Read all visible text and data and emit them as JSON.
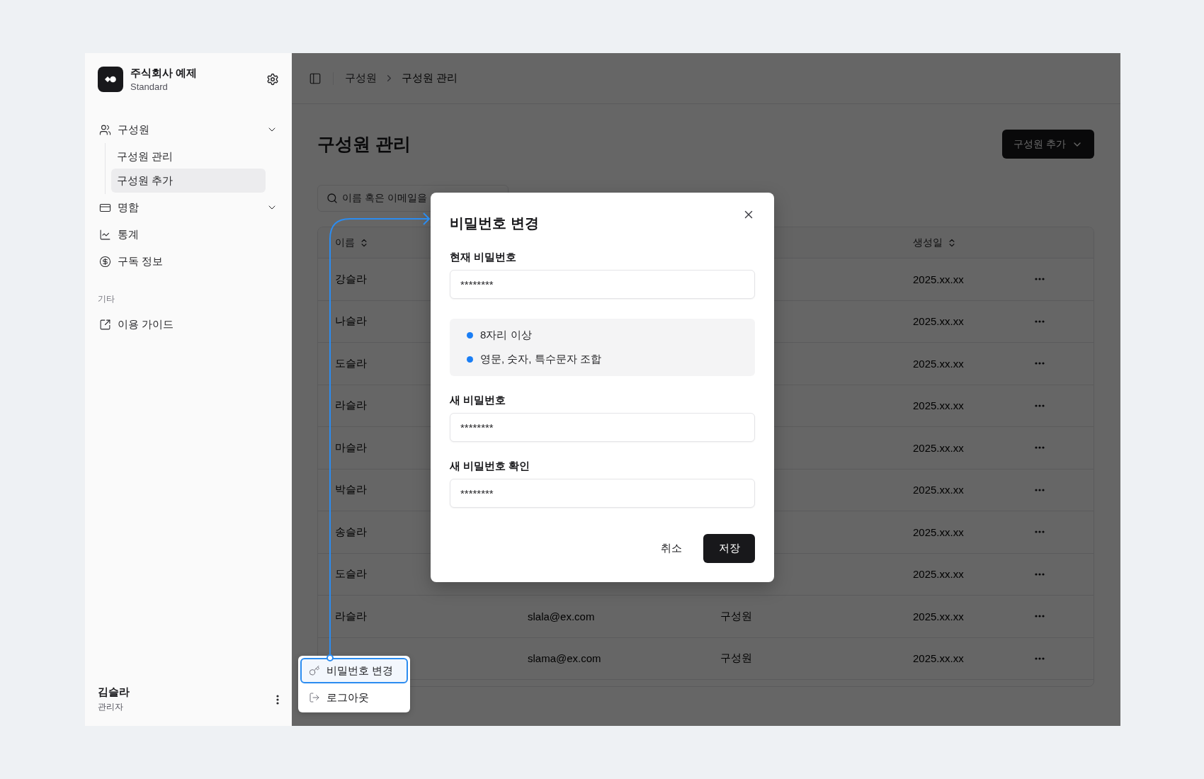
{
  "sidebar": {
    "org": {
      "name": "주식회사 예제",
      "plan": "Standard"
    },
    "nav": [
      {
        "label": "구성원",
        "kind": "group",
        "selected": false,
        "children": [
          {
            "label": "구성원 관리",
            "selected": false
          },
          {
            "label": "구성원 추가",
            "selected": true
          }
        ]
      },
      {
        "label": "명함",
        "kind": "group",
        "selected": false
      },
      {
        "label": "통계",
        "kind": "link",
        "selected": false
      },
      {
        "label": "구독 정보",
        "kind": "link",
        "selected": false
      }
    ],
    "section": "기타",
    "links": [
      {
        "label": "이용 가이드",
        "selected": false
      }
    ],
    "user": {
      "name": "김슬라",
      "role": "관리자"
    }
  },
  "main": {
    "breadcrumb": [
      "구성원",
      "구성원 관리"
    ],
    "title": "구성원 관리",
    "add_button": "구성원 추가",
    "search": {
      "placeholder": "이름 혹은 이메일을"
    },
    "table": {
      "name_header": "이름",
      "date_header": "생성일",
      "rows": [
        {
          "name": "강슬라",
          "date": "2025.xx.xx"
        },
        {
          "name": "나슬라",
          "date": "2025.xx.xx"
        },
        {
          "name": "도슬라",
          "date": "2025.xx.xx"
        },
        {
          "name": "라슬라",
          "date": "2025.xx.xx"
        },
        {
          "name": "마슬라",
          "date": "2025.xx.xx"
        },
        {
          "name": "박슬라",
          "date": "2025.xx.xx"
        },
        {
          "name": "송슬라",
          "date": "2025.xx.xx"
        },
        {
          "name": "도슬라",
          "date": "2025.xx.xx"
        },
        {
          "name": "라슬라",
          "email": "slala@ex.com",
          "role": "구성원",
          "date": "2025.xx.xx"
        },
        {
          "email": "slama@ex.com",
          "role": "구성원",
          "date": "2025.xx.xx"
        }
      ]
    }
  },
  "modal": {
    "title": "비밀번호 변경",
    "body": [
      {
        "kind": "field",
        "label": "현재 비밀번호",
        "value": "********"
      },
      {
        "kind": "rules",
        "items": [
          {
            "text": "8자리 이상",
            "met": true
          },
          {
            "text": "영문, 숫자, 특수문자 조합",
            "met": true
          }
        ]
      },
      {
        "kind": "field",
        "label": "새 비밀번호",
        "value": "********"
      },
      {
        "kind": "field",
        "label": "새 비밀번호 확인",
        "value": "********"
      }
    ],
    "cancel": "취소",
    "save": "저장"
  },
  "menu": [
    {
      "label": "비밀번호 변경",
      "selected": true
    },
    {
      "label": "로그아웃",
      "selected": false
    }
  ]
}
